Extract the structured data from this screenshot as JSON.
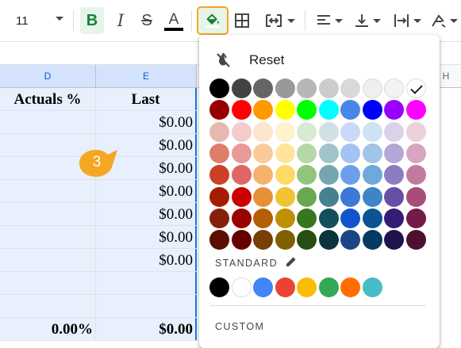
{
  "toolbar": {
    "font_size": "11",
    "bold_label": "B",
    "italic_label": "I",
    "strike_label": "S",
    "text_color_label": "A",
    "accent_color": "#f5a623"
  },
  "sheet": {
    "columns": [
      "D",
      "E",
      "H"
    ],
    "header_row": {
      "d": "Actuals %",
      "e": "Last"
    },
    "rows": [
      {
        "d": "",
        "e": "$0.00"
      },
      {
        "d": "",
        "e": "$0.00"
      },
      {
        "d": "",
        "e": "$0.00"
      },
      {
        "d": "",
        "e": "$0.00"
      },
      {
        "d": "",
        "e": "$0.00"
      },
      {
        "d": "",
        "e": "$0.00"
      },
      {
        "d": "",
        "e": "$0.00"
      },
      {
        "d": "",
        "e": ""
      },
      {
        "d": "",
        "e": ""
      },
      {
        "d": "0.00%",
        "e": "$0.00"
      }
    ],
    "callout_number": "3",
    "callout_color": "#f5a623",
    "selection_color": "#e8f0fe"
  },
  "palette": {
    "reset_label": "Reset",
    "standard_label": "STANDARD",
    "custom_label": "CUSTOM",
    "selected_color": "#ffffff",
    "grid": [
      [
        "#000000",
        "#434343",
        "#666666",
        "#999999",
        "#b7b7b7",
        "#cccccc",
        "#d9d9d9",
        "#efefef",
        "#f3f3f3",
        "#ffffff"
      ],
      [
        "#980000",
        "#ff0000",
        "#ff9900",
        "#ffff00",
        "#00ff00",
        "#00ffff",
        "#4a86e8",
        "#0000ff",
        "#9900ff",
        "#ff00ff"
      ],
      [
        "#e6b8af",
        "#f4cccc",
        "#fce5cd",
        "#fff2cc",
        "#d9ead3",
        "#d0e0e3",
        "#c9daf8",
        "#cfe2f3",
        "#d9d2e9",
        "#ead1dc"
      ],
      [
        "#dd7e6b",
        "#ea9999",
        "#f9cb9c",
        "#ffe599",
        "#b6d7a8",
        "#a2c4c9",
        "#a4c2f4",
        "#9fc5e8",
        "#b4a7d6",
        "#d5a6bd"
      ],
      [
        "#cc4125",
        "#e06666",
        "#f6b26b",
        "#ffd966",
        "#93c47d",
        "#76a5af",
        "#6d9eeb",
        "#6fa8dc",
        "#8e7cc3",
        "#c27ba0"
      ],
      [
        "#a61c00",
        "#cc0000",
        "#e69138",
        "#f1c232",
        "#6aa84f",
        "#45818e",
        "#3c78d8",
        "#3d85c6",
        "#674ea7",
        "#a64d79"
      ],
      [
        "#85200c",
        "#990000",
        "#b45f06",
        "#bf9000",
        "#38761d",
        "#134f5c",
        "#1155cc",
        "#0b5394",
        "#351c75",
        "#741b47"
      ],
      [
        "#5b0f00",
        "#660000",
        "#783f04",
        "#7f6000",
        "#274e13",
        "#0c343d",
        "#1c4587",
        "#073763",
        "#20124d",
        "#4c1130"
      ]
    ],
    "standard": [
      "#000000",
      "#ffffff",
      "#4285f4",
      "#ea4335",
      "#fbbc04",
      "#34a853",
      "#ff6d01",
      "#46bdc6"
    ]
  }
}
